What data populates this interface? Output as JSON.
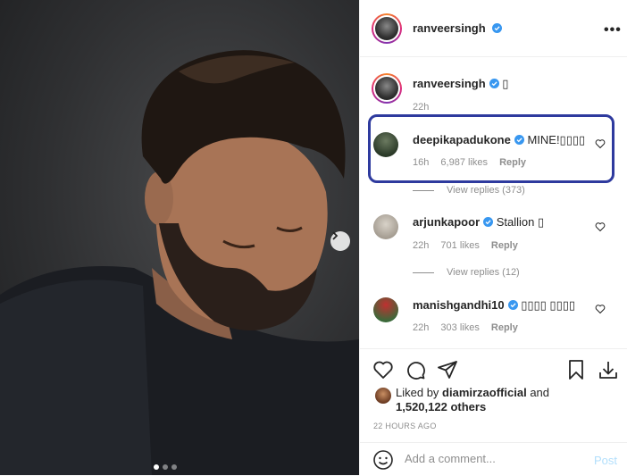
{
  "post": {
    "author": "ranveersingh",
    "more_label": "•••"
  },
  "caption": {
    "user": "ranveersingh",
    "text": "▯",
    "time": "22h"
  },
  "comments": [
    {
      "user": "deepikapadukone",
      "text": "MINE!▯▯▯▯",
      "time": "16h",
      "likes": "6,987 likes",
      "reply": "Reply",
      "view_replies": "View replies (373)"
    },
    {
      "user": "arjunkapoor",
      "text": "Stallion ▯",
      "time": "22h",
      "likes": "701 likes",
      "reply": "Reply",
      "view_replies": "View replies (12)"
    },
    {
      "user": "manishgandhi10",
      "text": "▯▯▯▯ ▯▯▯▯",
      "time": "22h",
      "likes": "303 likes",
      "reply": "Reply"
    }
  ],
  "likes": {
    "prefix": "Liked by",
    "user": "diamirzaofficial",
    "and": "and",
    "others": "1,520,122 others"
  },
  "timestamp": "22 HOURS AGO",
  "add_comment": {
    "placeholder": "Add a comment...",
    "post_label": "Post"
  },
  "colors": {
    "verified": "#3897f0",
    "highlight_box": "#2e3a9e",
    "post_button": "#b2dffc"
  },
  "icons": [
    "heart-icon",
    "comment-icon",
    "share-icon",
    "bookmark-icon",
    "download-icon",
    "emoji-icon",
    "chevron-right-icon"
  ]
}
